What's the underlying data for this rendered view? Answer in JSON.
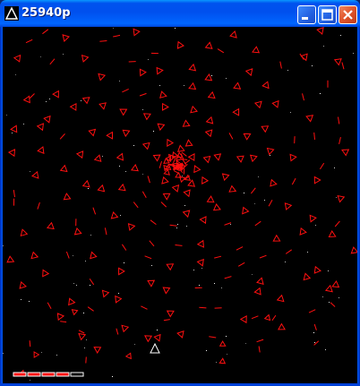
{
  "window": {
    "title": "25940p",
    "app_icon": "triangle-icon",
    "controls": [
      "minimize-icon",
      "maximize-icon",
      "close-icon"
    ]
  },
  "game": {
    "score_text": "25940p",
    "enemy_color": "#ff1010",
    "player_color": "#ffffff",
    "star_color": "#ffffff",
    "health_bar_color": "#ff1010",
    "health": {
      "segments_total": 5,
      "segments_filled": 4
    }
  },
  "colors": {
    "titlebar": "#0055ea",
    "background": "#000000",
    "close_button": "#e0542a"
  }
}
